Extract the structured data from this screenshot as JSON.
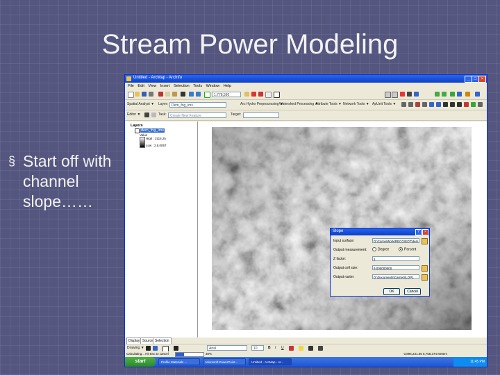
{
  "slide": {
    "title": "Stream Power Modeling",
    "bullet_mark": "§",
    "bullet_text": "Start off with channel slope……"
  },
  "arcmap": {
    "window_title": "Untitled - ArcMap - ArcInfo",
    "menu": [
      "File",
      "Edit",
      "View",
      "Insert",
      "Selection",
      "Tools",
      "Window",
      "Help"
    ],
    "toolbar1": {
      "scale": "1:778,590"
    },
    "toolbar2": {
      "spatial_analyst": "Spatial Analyst ▼",
      "layer_label": "Layer:",
      "layer_value": "Dem_fng_ims",
      "hydro1": "Arc Hydro Preprocessing ▼",
      "hydro2": "Watershed Processing ▼",
      "attribute": "Attribute Tools ▼",
      "network": "Network Tools ▼",
      "apunit": "ApUnit Tools ▼"
    },
    "toolbar3": {
      "editor": "Editor ▼",
      "task_label": "Task:",
      "task_value": "Create New Feature",
      "target_label": "Target:"
    },
    "toc": {
      "layers": "Layers",
      "layer_name": "dem_fng_ims",
      "value_label": "Value",
      "high": "High : 3115.25",
      "low": "Low : 2.5,0057"
    },
    "toc_tabs": [
      "Display",
      "Source",
      "Selection"
    ],
    "dialog": {
      "title": "Slope",
      "input_label": "Input surface:",
      "input_value": "D:\\Carrie\\Work\\RECG\\EQT\\dem_",
      "measurement_label": "Output measurement:",
      "radio_degree": "Degree",
      "radio_percent": "Percent",
      "z_label": "Z factor:",
      "z_value": "1",
      "cell_label": "Output cell size:",
      "cell_value": "9.000000000",
      "raster_label": "Output raster:",
      "raster_value": "D:\\Documents\\Carrie\\SLOP1",
      "ok": "OK",
      "cancel": "Cancel"
    },
    "drawbar": {
      "drawing": "Drawing ▼",
      "font": "Arial",
      "size": "10"
    },
    "status": {
      "left": "Calculating... Hit Esc to cancel",
      "progress_text": "30%",
      "coords": "-3,894,231.55  5,758,374 Meters"
    },
    "taskbar": {
      "start": "start",
      "items": [
        "Profile Materials ...",
        "Microsoft PowerPoint...",
        "Untitled - ArcMap - Ar..."
      ],
      "clock": "11:45 PM"
    }
  }
}
